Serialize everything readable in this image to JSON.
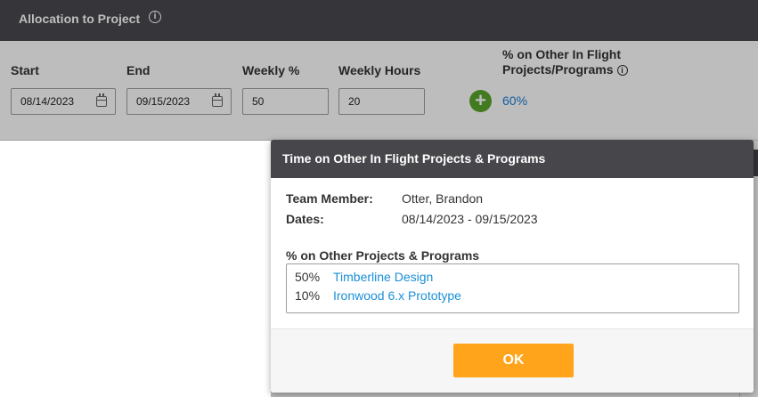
{
  "panel": {
    "title": "Allocation to Project",
    "info_icon": "i",
    "labels": {
      "start": "Start",
      "end": "End",
      "weekly_pct": "Weekly %",
      "weekly_hours": "Weekly Hours",
      "other_line1": "% on Other In Flight",
      "other_line2": "Projects/Programs"
    },
    "values": {
      "start": "08/14/2023",
      "end": "09/15/2023",
      "weekly_pct": "50",
      "weekly_hours": "20",
      "other_pct": "60%"
    },
    "add_icon": "+",
    "small_info_icon": "i"
  },
  "modal": {
    "title": "Time on Other In Flight Projects & Programs",
    "team_member_label": "Team Member:",
    "team_member_value": "Otter, Brandon",
    "dates_label": "Dates:",
    "dates_value": "08/14/2023 - 09/15/2023",
    "list_title": "% on Other Projects & Programs",
    "items": [
      {
        "pct": "50%",
        "name": "Timberline Design"
      },
      {
        "pct": "10%",
        "name": "Ironwood 6.x Prototype"
      }
    ],
    "ok_label": "OK"
  },
  "colors": {
    "header_bg": "#46464b",
    "link": "#1a8fd8",
    "ok_button": "#ffa41b",
    "add_button": "#5aa52c"
  }
}
